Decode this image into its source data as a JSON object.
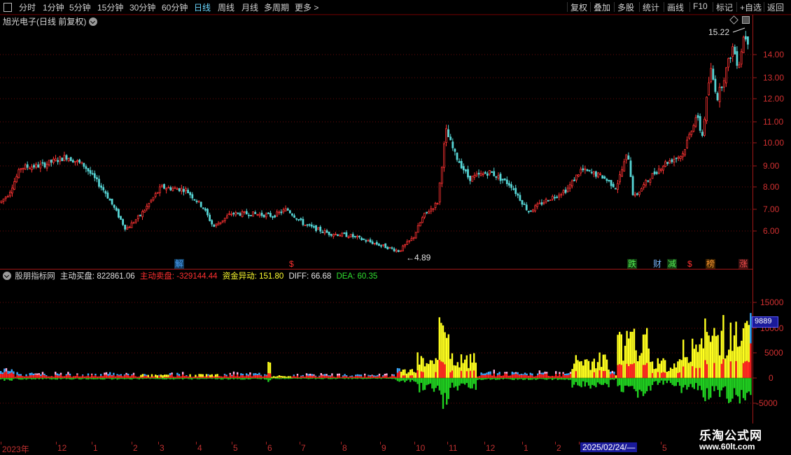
{
  "toolbar": {
    "periods": [
      "分时",
      "1分钟",
      "5分钟",
      "15分钟",
      "30分钟",
      "60分钟",
      "日线",
      "周线",
      "月线",
      "多周期",
      "更多 >"
    ],
    "active_period": "日线",
    "right_buttons": [
      "复权",
      "叠加",
      "多股",
      "统计",
      "画线",
      "F10",
      "标记",
      "+自选",
      "返回"
    ]
  },
  "stock": {
    "title": "旭光电子(日线 前复权)",
    "high_marker": "15.22",
    "low_marker": "4.89"
  },
  "price_axis": [
    "14.00",
    "13.00",
    "12.00",
    "11.00",
    "10.00",
    "9.00",
    "8.00",
    "7.00",
    "6.00"
  ],
  "events": [
    {
      "label": "解",
      "color": "#4aa3ff",
      "bg": "#103a5a"
    },
    {
      "label": "$",
      "color": "#ff3030",
      "bg": "#000000"
    },
    {
      "label": "跌",
      "color": "#55ee55",
      "bg": "#104010"
    },
    {
      "label": "财",
      "color": "#7ab8ff",
      "bg": "#000000"
    },
    {
      "label": "减",
      "color": "#55ee55",
      "bg": "#103a10"
    },
    {
      "label": "$",
      "color": "#ff3030",
      "bg": "#000000"
    },
    {
      "label": "榜",
      "color": "#ff9a30",
      "bg": "#3a2000"
    },
    {
      "label": "涨",
      "color": "#ff5050",
      "bg": "#3a1010"
    }
  ],
  "indicator": {
    "name": "股朋指标网",
    "buy_label": "主动买盘:",
    "buy_value": "822861.06",
    "sell_label": "主动卖盘:",
    "sell_value": "-329144.44",
    "flow_label": "资金异动:",
    "flow_value": "151.80",
    "diff_label": "DIFF:",
    "diff_value": "66.68",
    "dea_label": "DEA:",
    "dea_value": "60.35"
  },
  "ind_axis": [
    "15000",
    "10000",
    "5000",
    "0",
    "-5000"
  ],
  "ind_tag": "9889",
  "dates": [
    "2023年",
    "12",
    "1",
    "2",
    "3",
    "4",
    "5",
    "6",
    "7",
    "8",
    "9",
    "10",
    "11",
    "12",
    "1",
    "2",
    "2025/02/24/—",
    "5"
  ],
  "watermark": {
    "line1": "乐淘公式网",
    "line2": "www.60lt.com"
  },
  "chart_data": {
    "type": "candlestick+bar",
    "series": [
      {
        "name": "主动买盘",
        "values": [
          822861.06
        ]
      },
      {
        "name": "主动卖盘",
        "values": [
          -329144.44
        ]
      }
    ],
    "price_range": [
      4.89,
      15.22
    ],
    "ind_range": [
      -5000,
      15000
    ],
    "colors": {
      "up": "#ff3232",
      "down": "#56d4d4",
      "buy": "#ffff1e",
      "sell": "#20d020",
      "accent": "#ff3030"
    }
  }
}
